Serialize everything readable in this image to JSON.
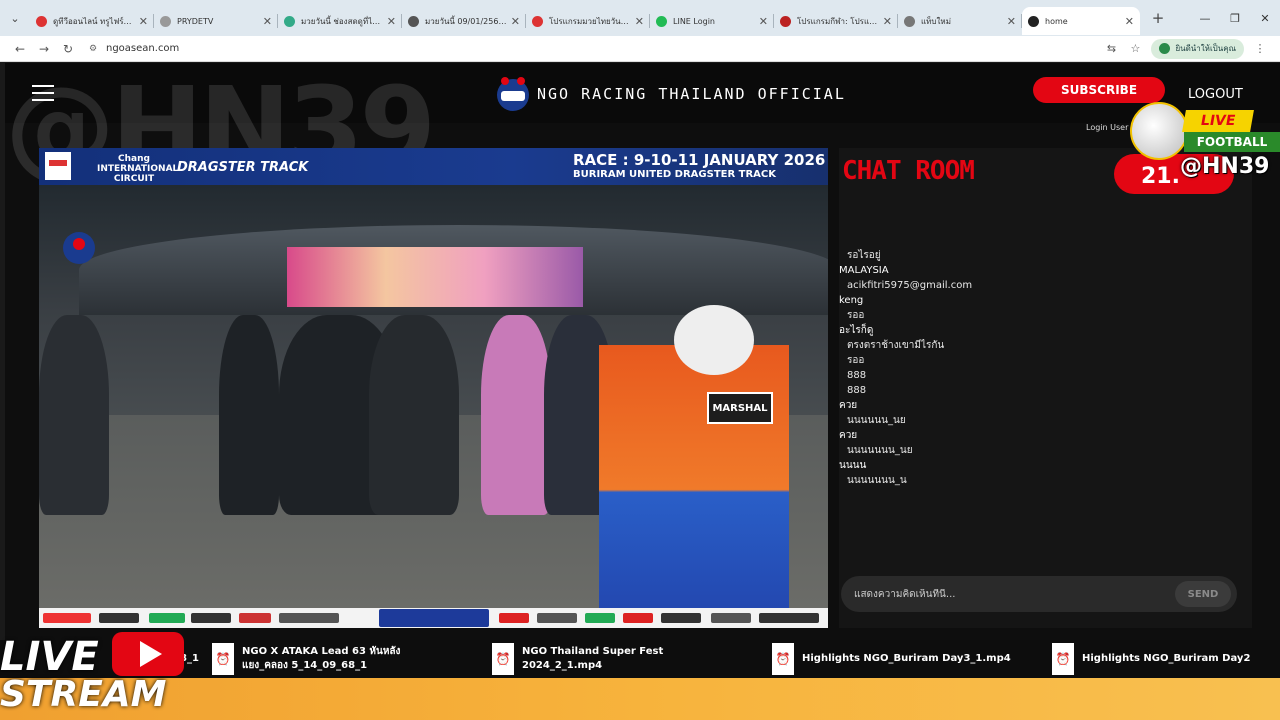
{
  "browser": {
    "tabs": [
      {
        "title": "ดูทีวีออนไลน์ ทรูไฟร์ฟ ทีวี",
        "color": "#d33"
      },
      {
        "title": "PRYDETV",
        "color": "#999"
      },
      {
        "title": "มวยวันนี้ ช่องสดดูที่ไหน",
        "color": "#3a8"
      },
      {
        "title": "มวยวันนี้ 09/01/2569 ช่อง",
        "color": "#555"
      },
      {
        "title": "โปรแกรมมวยไทยวันนี้ ดี",
        "color": "#d33"
      },
      {
        "title": "LINE Login",
        "color": "#2b5"
      },
      {
        "title": "โปรแกรมกีฬา: โปรแกรม",
        "color": "#b22"
      },
      {
        "title": "แท็บใหม่",
        "color": "#777"
      },
      {
        "title": "home",
        "color": "#222"
      }
    ],
    "url": "ngoasean.com",
    "profile_label": "ยินดีนำให้เป็นคุณ"
  },
  "header": {
    "brand": "NGO RACING THAILAND OFFICIAL",
    "subscribe": "SUBSCRIBE",
    "logout": "LOGOUT",
    "login_user": "Login User",
    "watermark": "@HN39"
  },
  "video": {
    "banner_logo1": "Chang INTERNATIONAL CIRCUIT",
    "banner_logo2": "DRAGSTER TRACK",
    "race": "RACE : 9-10-11 JANUARY 2026",
    "track": "BURIRAM UNITED DRAGSTER TRACK",
    "marshal": "MARSHAL"
  },
  "chat": {
    "title": "CHAT ROOM",
    "messages": [
      {
        "user": "",
        "text": "รอไรอยู่"
      },
      {
        "user": "MALAYSIA",
        "text": "acikfitri5975@gmail.com"
      },
      {
        "user": "keng",
        "text": "รออ"
      },
      {
        "user": "อะไรก็ดู",
        "text": "ตรงตราช้างเขามีไรกัน"
      },
      {
        "user": "",
        "text": "รออ"
      },
      {
        "user": "",
        "text": ""
      },
      {
        "user": "",
        "text": "888"
      },
      {
        "user": "",
        "text": ""
      },
      {
        "user": "",
        "text": "888"
      },
      {
        "user": "",
        "text": ""
      },
      {
        "user": "ควย",
        "text": "นนนนนน_นย"
      },
      {
        "user": "ควย",
        "text": "นนนนนนน_นย"
      },
      {
        "user": "นนนน",
        "text": "นนนนนนน_น"
      }
    ],
    "placeholder": "แสดงความคิดเห็นที่นี่...",
    "send": "SEND"
  },
  "overlay": {
    "live": "LIVE",
    "football": "FOOTBALL",
    "number": "21.",
    "handle": "@HN39"
  },
  "strip": {
    "items": [
      {
        "line1": "8_1",
        "line2": ""
      },
      {
        "line1": "NGO X ATAKA Lead 63 หันหลัง",
        "line2": "แยง_คลอง 5_14_09_68_1"
      },
      {
        "line1": "NGO Thailand Super Fest",
        "line2": "2024_2_1.mp4"
      },
      {
        "line1": "Highlights NGO_Buriram Day3_1.mp4",
        "line2": ""
      },
      {
        "line1": "Highlights NGO_Buriram Day2",
        "line2": ""
      }
    ]
  },
  "livestream": {
    "line1": "LIVE",
    "line2": "STREAM"
  }
}
